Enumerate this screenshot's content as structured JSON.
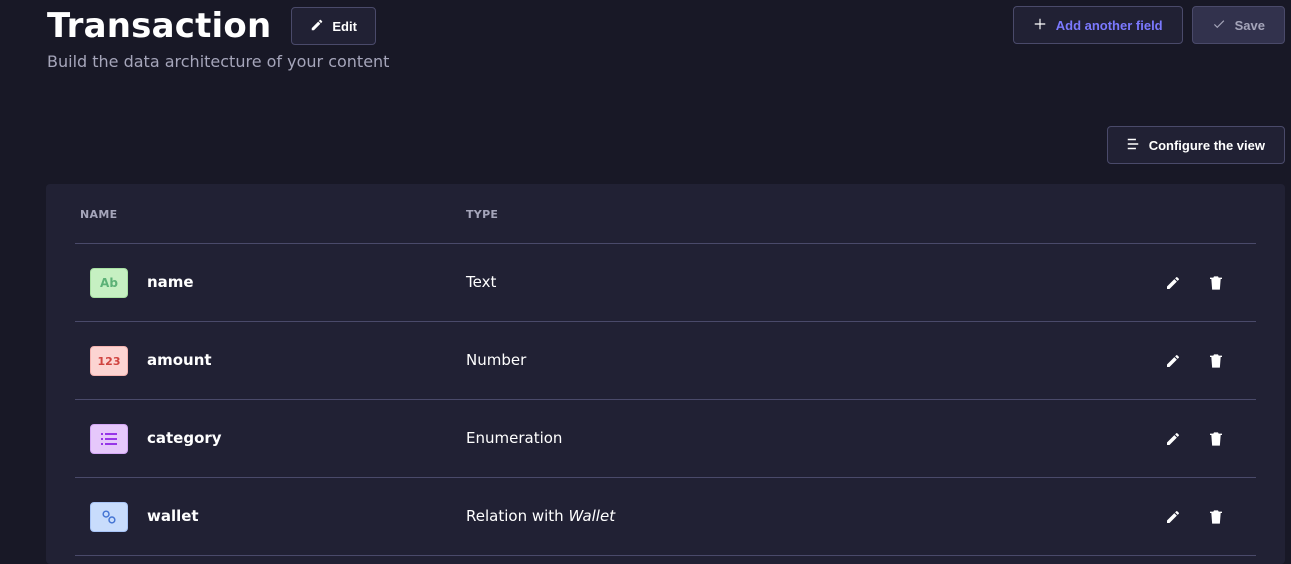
{
  "header": {
    "title": "Transaction",
    "edit_label": "Edit",
    "subtitle": "Build the data architecture of your content"
  },
  "actions": {
    "add_field_label": "Add another field",
    "save_label": "Save",
    "configure_label": "Configure the view"
  },
  "table": {
    "columns": [
      "NAME",
      "TYPE"
    ],
    "rows": [
      {
        "icon_text": "Ab",
        "icon": "text-type-icon",
        "name": "name",
        "type": "Text",
        "type_target": ""
      },
      {
        "icon_text": "123",
        "icon": "number-type-icon",
        "name": "amount",
        "type": "Number",
        "type_target": ""
      },
      {
        "icon_text": "",
        "icon": "enumeration-type-icon",
        "name": "category",
        "type": "Enumeration",
        "type_target": ""
      },
      {
        "icon_text": "",
        "icon": "relation-type-icon",
        "name": "wallet",
        "type": "Relation with ",
        "type_target": "Wallet"
      }
    ]
  },
  "colors": {
    "background": "#181826",
    "card": "#212134",
    "accent": "#7b79ff"
  }
}
